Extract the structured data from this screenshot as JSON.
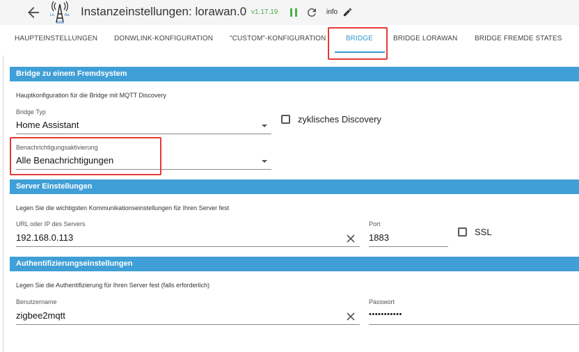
{
  "header": {
    "title": "Instanzeinstellungen: lorawan.0",
    "version": "v1.17.19",
    "log_level": "info",
    "logo_text_top": "Lo",
    "logo_text_right": "Ra",
    "logo_text_bottom": "WAN"
  },
  "tabs": [
    {
      "label": "HAUPTEINSTELLUNGEN"
    },
    {
      "label": "DONWLINK-KONFIGURATION"
    },
    {
      "label": "\"CUSTOM\"-KONFIGURATION"
    },
    {
      "label": "BRIDGE"
    },
    {
      "label": "BRIDGE LORAWAN"
    },
    {
      "label": "BRIDGE FREMDE STATES"
    }
  ],
  "active_tab": "BRIDGE",
  "sections": {
    "bridge": {
      "title": "Bridge zu einem Fremdsystem",
      "description": "Hauptkonfiguration für die Bridge mit MQTT Discovery",
      "bridge_type_label": "Bridge Typ",
      "bridge_type_value": "Home Assistant",
      "cyclic_discovery_label": "zyklisches Discovery",
      "cyclic_discovery_checked": false,
      "notification_label": "Benachrichtigungsaktivierung",
      "notification_value": "Alle Benachrichtigungen"
    },
    "server": {
      "title": "Server Einstellungen",
      "description": "Legen Sie die wichtigsten Kommunikationseinstellungen für Ihren Server fest",
      "url_label": "URL oder IP des Servers",
      "url_value": "192.168.0.113",
      "port_label": "Port",
      "port_value": "1883",
      "ssl_label": "SSL",
      "ssl_checked": false
    },
    "auth": {
      "title": "Authentifizierungseinstellungen",
      "description": "Legen Sie die Authentifizierung für Ihren Server fest (falls erforderlich)",
      "username_label": "Benutzername",
      "username_value": "zigbee2mqtt",
      "password_label": "Passwort",
      "password_value": "•••••••••••"
    }
  },
  "colors": {
    "accent": "#3399cc",
    "section_bar": "#3f9fd6",
    "highlight": "#e53935",
    "version": "#4caf50"
  },
  "icons": {
    "back": "arrow-left-icon",
    "logo": "lorawan-logo-icon",
    "pause": "pause-icon",
    "reload": "reload-icon",
    "edit": "pencil-icon",
    "dropdown": "caret-down-icon",
    "clear": "close-icon"
  }
}
